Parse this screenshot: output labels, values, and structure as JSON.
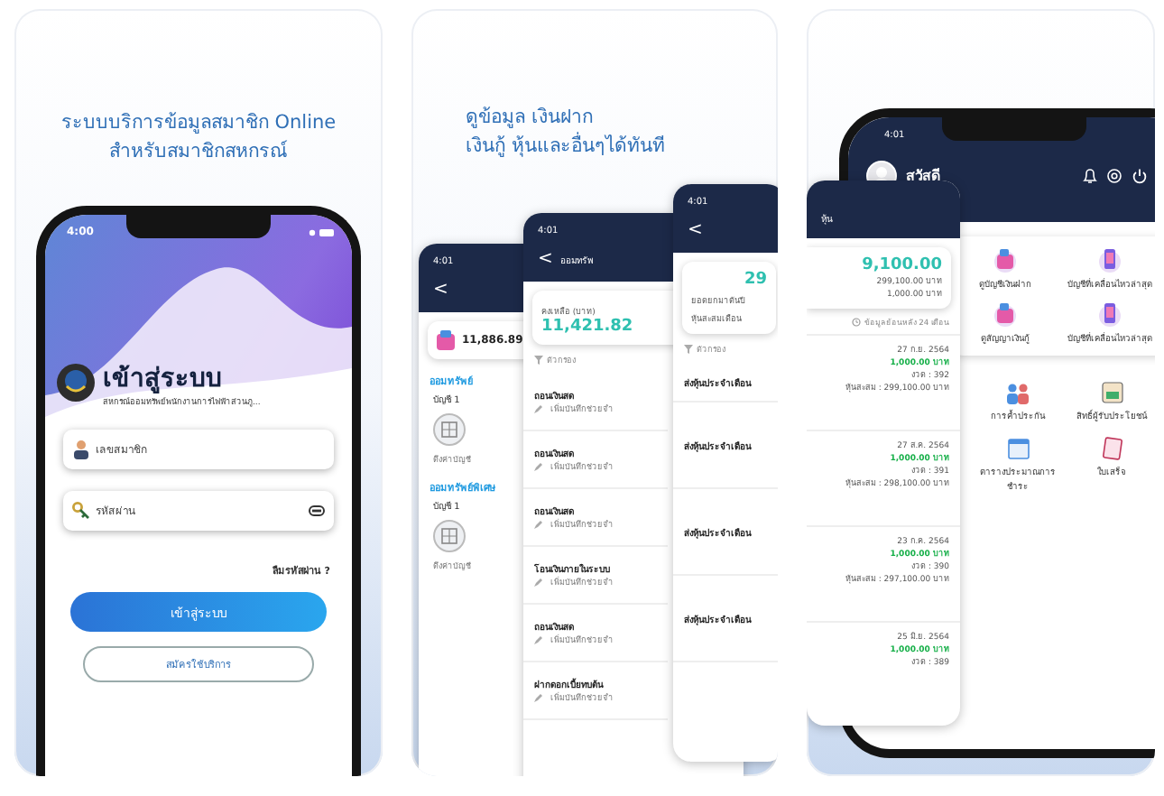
{
  "login_panel": {
    "caption": [
      "ระบบบริการข้อมูลสมาชิก Online",
      "สำหรับสมาชิกสหกรณ์"
    ],
    "time": "4:00",
    "title": "เข้าสู่ระบบ",
    "subtitle": "สหกรณ์ออมทรัพย์พนักงานการไฟฟ้าส่วนภู...",
    "fields": [
      {
        "kind": "user",
        "placeholder": "เลขสมาชิก"
      },
      {
        "kind": "password",
        "placeholder": "รหัสผ่าน"
      }
    ],
    "forgot": "ลืมรหัสผ่าน ?",
    "buttons": [
      {
        "kind": "primary",
        "label": "เข้าสู่ระบบ"
      },
      {
        "kind": "outline",
        "label": "สมัครใช้บริการ"
      }
    ]
  },
  "accounts_panel": {
    "caption": [
      "ดูข้อมูล เงินฝาก",
      "เงินกู้ หุ้นและอื่นๆได้ทันที"
    ],
    "summary_screen": {
      "time": "4:01",
      "back": "<",
      "total": "11,886.89",
      "sections": [
        {
          "title": "ออมทรัพย์",
          "account": "บัญชี 1",
          "action": "ดึงค่าบัญชี"
        },
        {
          "title": "ออมทรัพย์พิเศษ",
          "account": "บัญชี 1",
          "action": "ดึงค่าบัญชี"
        }
      ]
    },
    "statement_screen": {
      "time": "4:01",
      "back": "<",
      "title": "ออมทรัพ",
      "balance_label": "คงเหลือ (บาท)",
      "balance": "11,421.82",
      "filter": "ตัวกรอง",
      "rows": [
        {
          "title": "ถอนเงินสด",
          "note": "เพิ่มบันทึกช่วยจำ"
        },
        {
          "title": "ถอนเงินสด",
          "note": "เพิ่มบันทึกช่วยจำ"
        },
        {
          "title": "ถอนเงินสด",
          "note": "เพิ่มบันทึกช่วยจำ"
        },
        {
          "title": "โอนเงินภายในระบบ",
          "note": "เพิ่มบันทึกช่วยจำ"
        },
        {
          "title": "ถอนเงินสด",
          "note": "เพิ่มบันทึกช่วยจำ"
        },
        {
          "title": "ฝากดอกเบี้ยทบต้น",
          "note": "เพิ่มบันทึกช่วยจำ"
        }
      ]
    },
    "shares_screen": {
      "time": "4:01",
      "back": "<",
      "amount": "29",
      "labels": [
        "ยอดยกมาต้นปี",
        "หุ้นสะสมเดือน"
      ],
      "filter": "ตัวกรอง",
      "rows": [
        "ส่งหุ้นประจำเดือน",
        "ส่งหุ้นประจำเดือน",
        "ส่งหุ้นประจำเดือน",
        "ส่งหุ้นประจำเดือน"
      ]
    }
  },
  "home_panel": {
    "time": "4:01",
    "greeting": "สวัสดี",
    "tiles": [
      {
        "label": "ดูบัญชีเงินฝาก"
      },
      {
        "label": "บัญชีที่เคลื่อนไหวล่าสุด"
      },
      {
        "label": "ดูสัญญาเงินกู้"
      },
      {
        "label": "บัญชีที่เคลื่อนไหวล่าสุด"
      }
    ],
    "menu": [
      {
        "kind": "people",
        "label": "การค้ำประกัน"
      },
      {
        "kind": "certificate",
        "label": "สิทธิ์ผู้รับประโยชน์"
      },
      {
        "kind": "calendar",
        "label": "ตารางประมาณการชำระ"
      },
      {
        "kind": "receipt",
        "label": "ใบเสร็จ"
      }
    ],
    "share_overlay": {
      "title": "หุ้น",
      "amount": "9,100.00",
      "lines": [
        "299,100.00 บาท",
        "1,000.00 บาท"
      ],
      "history": "ข้อมูลย้อนหลัง 24 เดือน",
      "entries": [
        {
          "date": "27 ก.ย. 2564",
          "amount": "1,000.00 บาท",
          "period": "งวด : 392",
          "total": "หุ้นสะสม : 299,100.00 บาท"
        },
        {
          "date": "27 ส.ค. 2564",
          "amount": "1,000.00 บาท",
          "period": "งวด : 391",
          "total": "หุ้นสะสม : 298,100.00 บาท"
        },
        {
          "date": "23 ก.ค. 2564",
          "amount": "1,000.00 บาท",
          "period": "งวด : 390",
          "total": "หุ้นสะสม : 297,100.00 บาท"
        },
        {
          "date": "25 มิ.ย. 2564",
          "amount": "1,000.00 บาท",
          "period": "งวด : 389"
        }
      ]
    }
  }
}
